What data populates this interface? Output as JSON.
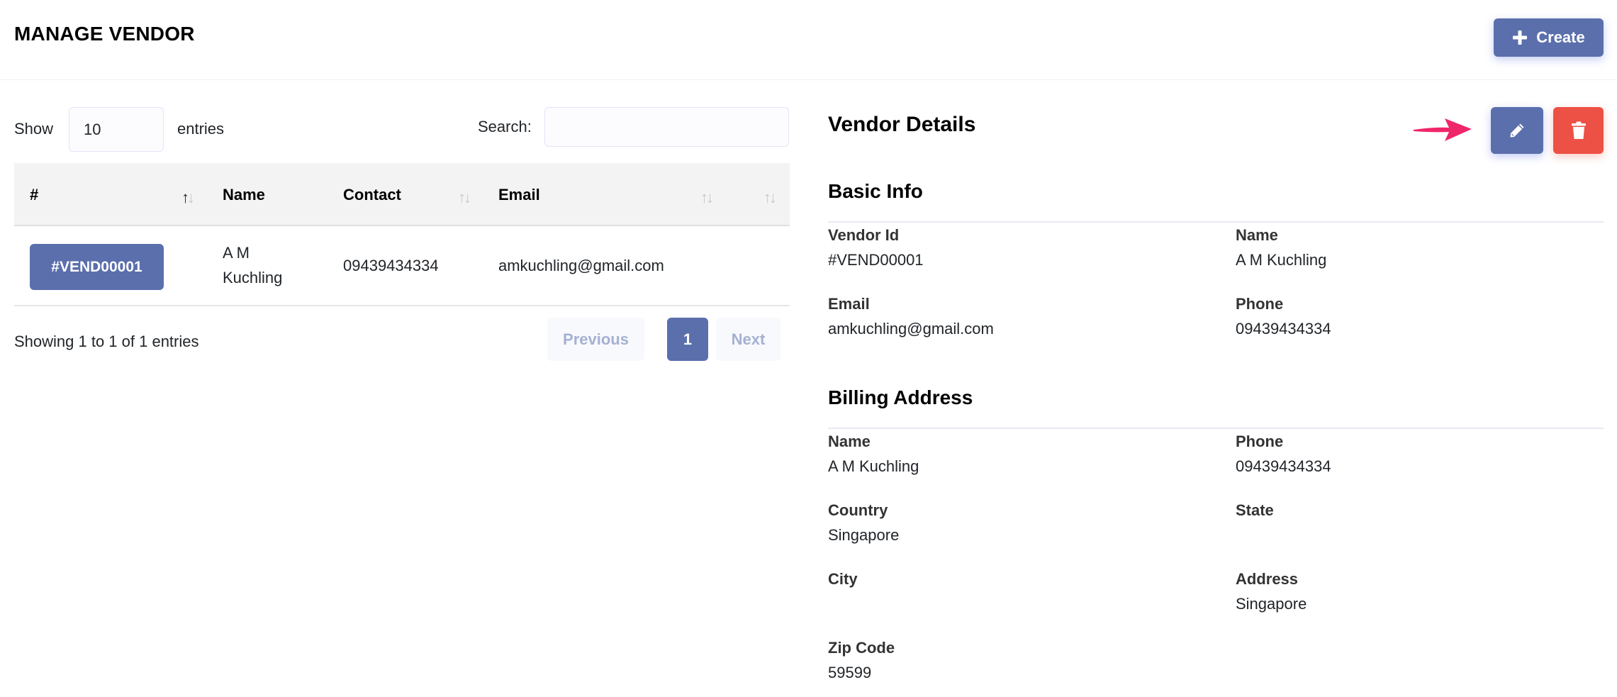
{
  "header": {
    "title": "MANAGE VENDOR",
    "create_label": "Create",
    "create_icon": "plus-icon"
  },
  "table_controls": {
    "show_label": "Show",
    "page_length": "10",
    "entries_label": "entries",
    "search_label": "Search:",
    "search_value": "",
    "search_placeholder": ""
  },
  "table": {
    "columns": [
      {
        "label": "#",
        "sort": "ascending"
      },
      {
        "label": "Name",
        "sort": "none"
      },
      {
        "label": "Contact",
        "sort": "none"
      },
      {
        "label": "Email",
        "sort": "none"
      },
      {
        "label": "",
        "sort": "none"
      }
    ],
    "rows": [
      {
        "id": "#VEND00001",
        "name": "A M Kuchling",
        "name_line1": "A M",
        "name_line2": "Kuchling",
        "contact": "09439434334",
        "email": "amkuchling@gmail.com"
      }
    ],
    "sort_icon": "sort-arrows-icon"
  },
  "pagination": {
    "info": "Showing 1 to 1 of 1 entries",
    "previous_label": "Previous",
    "current_page": "1",
    "next_label": "Next"
  },
  "details": {
    "title": "Vendor Details",
    "edit_icon": "pencil-icon",
    "delete_icon": "trash-icon",
    "annotation_icon": "arrow-right-icon",
    "colors": {
      "primary": "#5a6fac",
      "danger": "#ed5145",
      "annotation": "#f0266a"
    },
    "basic_info": {
      "title": "Basic Info",
      "fields": [
        {
          "label": "Vendor Id",
          "value": "#VEND00001"
        },
        {
          "label": "Name",
          "value": "A M Kuchling"
        },
        {
          "label": "Email",
          "value": "amkuchling@gmail.com"
        },
        {
          "label": "Phone",
          "value": "09439434334"
        }
      ]
    },
    "billing_address": {
      "title": "Billing Address",
      "fields": [
        {
          "label": "Name",
          "value": "A M Kuchling"
        },
        {
          "label": "Phone",
          "value": "09439434334"
        },
        {
          "label": "Country",
          "value": "Singapore"
        },
        {
          "label": "State",
          "value": ""
        },
        {
          "label": "City",
          "value": ""
        },
        {
          "label": "Address",
          "value": "Singapore"
        },
        {
          "label": "Zip Code",
          "value": "59599"
        }
      ]
    }
  }
}
